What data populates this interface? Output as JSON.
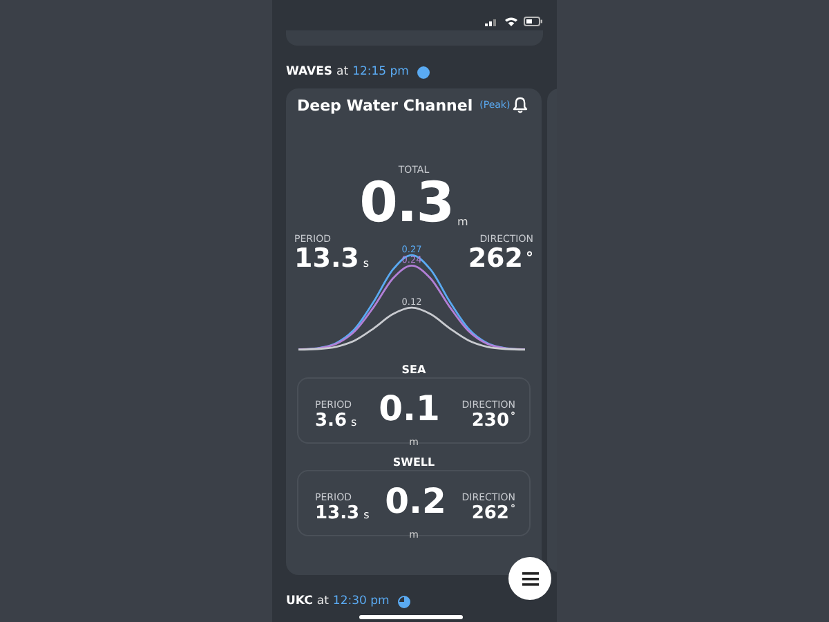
{
  "sections": [
    {
      "kind": "waves",
      "title": "WAVES",
      "at": "at",
      "time": "12:15 pm",
      "card": {
        "name": "Deep Water Channel",
        "tag": "(Peak)",
        "total_label": "TOTAL",
        "total_value": "0.3",
        "total_unit": "m",
        "period_label": "PERIOD",
        "period_value": "13.3",
        "period_unit": "s",
        "direction_label": "DIRECTION",
        "direction_value": "262",
        "direction_unit": "°",
        "curves": [
          {
            "label": "0.27",
            "color": "#5aaaf2"
          },
          {
            "label": "0.24",
            "color": "#b27fd6"
          },
          {
            "label": "0.12",
            "color": "#c9cbd0"
          }
        ],
        "components": [
          {
            "title": "SEA",
            "period_label": "PERIOD",
            "period_value": "3.6",
            "period_unit": "s",
            "height_value": "0.1",
            "height_unit": "m",
            "direction_label": "DIRECTION",
            "direction_value": "230",
            "direction_unit": "°"
          },
          {
            "title": "SWELL",
            "period_label": "PERIOD",
            "period_value": "13.3",
            "period_unit": "s",
            "height_value": "0.2",
            "height_unit": "m",
            "direction_label": "DIRECTION",
            "direction_value": "262",
            "direction_unit": "°"
          }
        ]
      }
    },
    {
      "kind": "ukc",
      "title": "UKC",
      "at": "at",
      "time": "12:30 pm"
    }
  ]
}
